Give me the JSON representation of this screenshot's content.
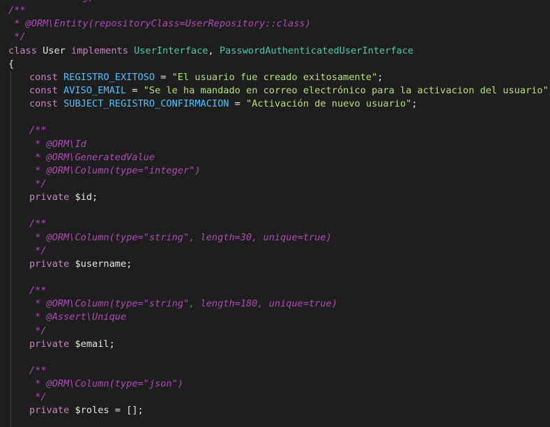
{
  "editor": {
    "lines": [
      {
        "indent": 0,
        "tokens": [
          {
            "t": "cmt-d",
            "v": "  * ...   ...g,"
          }
        ]
      },
      {
        "indent": 0,
        "tokens": [
          {
            "t": "cmt-d",
            "v": "/**"
          }
        ]
      },
      {
        "indent": 0,
        "tokens": [
          {
            "t": "cmt-d",
            "v": " * @ORM\\Entity(repositoryClass=UserRepository::class)"
          }
        ]
      },
      {
        "indent": 0,
        "tokens": [
          {
            "t": "cmt-d",
            "v": " */"
          }
        ]
      },
      {
        "indent": 0,
        "tokens": [
          {
            "t": "kw2",
            "v": "class "
          },
          {
            "t": "white",
            "v": "User "
          },
          {
            "t": "kw2",
            "v": "implements "
          },
          {
            "t": "cls",
            "v": "UserInterface"
          },
          {
            "t": "white",
            "v": ", "
          },
          {
            "t": "cls",
            "v": "PasswordAuthenticatedUserInterface"
          }
        ]
      },
      {
        "indent": 0,
        "tokens": [
          {
            "t": "white",
            "v": "{"
          }
        ]
      },
      {
        "indent": 1,
        "tokens": [
          {
            "t": "kw2",
            "v": "const "
          },
          {
            "t": "const",
            "v": "REGISTRO_EXITOSO"
          },
          {
            "t": "white",
            "v": " = "
          },
          {
            "t": "green",
            "v": "\"El usuario fue creado exitosamente\""
          },
          {
            "t": "white",
            "v": ";"
          }
        ]
      },
      {
        "indent": 1,
        "tokens": [
          {
            "t": "kw2",
            "v": "const "
          },
          {
            "t": "const",
            "v": "AVISO_EMAIL"
          },
          {
            "t": "white",
            "v": " = "
          },
          {
            "t": "green",
            "v": "\"Se le ha mandado en correo electrónico para la activacion del usuario\""
          },
          {
            "t": "white",
            "v": ";"
          }
        ]
      },
      {
        "indent": 1,
        "tokens": [
          {
            "t": "kw2",
            "v": "const "
          },
          {
            "t": "const",
            "v": "SUBJECT_REGISTRO_CONFIRMACION"
          },
          {
            "t": "white",
            "v": " = "
          },
          {
            "t": "green",
            "v": "\"Activación de nuevo usuario\""
          },
          {
            "t": "white",
            "v": ";"
          }
        ]
      },
      {
        "indent": 1,
        "tokens": []
      },
      {
        "indent": 1,
        "tokens": [
          {
            "t": "cmt-d",
            "v": "/**"
          }
        ]
      },
      {
        "indent": 1,
        "tokens": [
          {
            "t": "cmt-d",
            "v": " * @ORM\\Id"
          }
        ]
      },
      {
        "indent": 1,
        "tokens": [
          {
            "t": "cmt-d",
            "v": " * @ORM\\GeneratedValue"
          }
        ]
      },
      {
        "indent": 1,
        "tokens": [
          {
            "t": "cmt-d",
            "v": " * @ORM\\Column(type=\"integer\")"
          }
        ]
      },
      {
        "indent": 1,
        "tokens": [
          {
            "t": "cmt-d",
            "v": " */"
          }
        ]
      },
      {
        "indent": 1,
        "tokens": [
          {
            "t": "kw2",
            "v": "private "
          },
          {
            "t": "white",
            "v": "$id;"
          }
        ]
      },
      {
        "indent": 1,
        "tokens": []
      },
      {
        "indent": 1,
        "tokens": [
          {
            "t": "cmt-d",
            "v": "/**"
          }
        ]
      },
      {
        "indent": 1,
        "tokens": [
          {
            "t": "cmt-d",
            "v": " * @ORM\\Column(type=\"string\", length=30, unique=true)"
          }
        ]
      },
      {
        "indent": 1,
        "tokens": [
          {
            "t": "cmt-d",
            "v": " */"
          }
        ]
      },
      {
        "indent": 1,
        "tokens": [
          {
            "t": "kw2",
            "v": "private "
          },
          {
            "t": "white",
            "v": "$username;"
          }
        ]
      },
      {
        "indent": 1,
        "tokens": []
      },
      {
        "indent": 1,
        "tokens": [
          {
            "t": "cmt-d",
            "v": "/**"
          }
        ]
      },
      {
        "indent": 1,
        "tokens": [
          {
            "t": "cmt-d",
            "v": " * @ORM\\Column(type=\"string\", length=180, unique=true)"
          }
        ]
      },
      {
        "indent": 1,
        "tokens": [
          {
            "t": "cmt-d",
            "v": " * @Assert\\Unique"
          }
        ]
      },
      {
        "indent": 1,
        "tokens": [
          {
            "t": "cmt-d",
            "v": " */"
          }
        ]
      },
      {
        "indent": 1,
        "tokens": [
          {
            "t": "kw2",
            "v": "private "
          },
          {
            "t": "white",
            "v": "$email;"
          }
        ]
      },
      {
        "indent": 1,
        "tokens": []
      },
      {
        "indent": 1,
        "tokens": [
          {
            "t": "cmt-d",
            "v": "/**"
          }
        ]
      },
      {
        "indent": 1,
        "tokens": [
          {
            "t": "cmt-d",
            "v": " * @ORM\\Column(type=\"json\")"
          }
        ]
      },
      {
        "indent": 1,
        "tokens": [
          {
            "t": "cmt-d",
            "v": " */"
          }
        ]
      },
      {
        "indent": 1,
        "tokens": [
          {
            "t": "kw2",
            "v": "private "
          },
          {
            "t": "white",
            "v": "$roles "
          },
          {
            "t": "white",
            "v": "= "
          },
          {
            "t": "white",
            "v": "[];"
          }
        ]
      },
      {
        "indent": 1,
        "tokens": []
      },
      {
        "indent": 1,
        "tokens": []
      }
    ]
  },
  "colors": {
    "background": "#1e1e1e",
    "keyword": "#c586c0",
    "class": "#4ec9b0",
    "constant": "#4fc1ff",
    "string": "#b5e07a",
    "comment": "#b04ab8",
    "text": "#e6e6e6"
  }
}
